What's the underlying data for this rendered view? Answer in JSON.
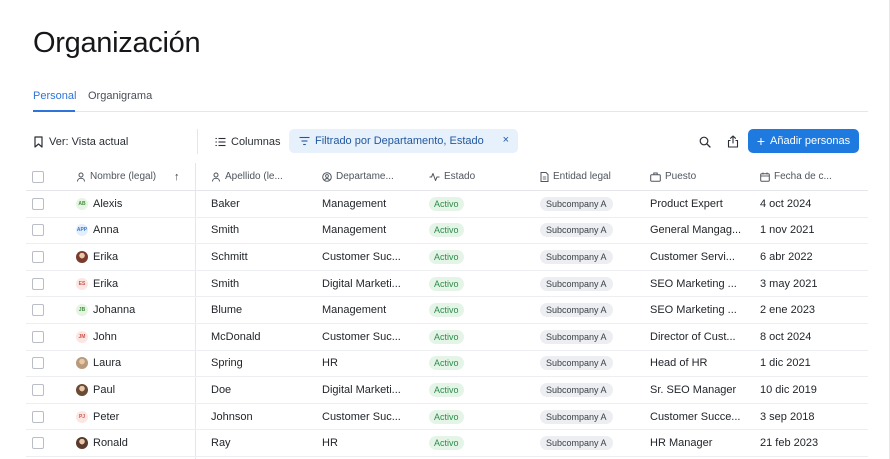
{
  "page": {
    "title": "Organización",
    "tabs": [
      {
        "label": "Personal",
        "active": true
      },
      {
        "label": "Organigrama",
        "active": false
      }
    ]
  },
  "toolbar": {
    "view_label": "Ver: Vista actual",
    "columns_label": "Columnas",
    "filter_label": "Filtrado por Departamento, Estado",
    "filter_clear": "×",
    "add_label": "Añadir personas",
    "add_plus": "+"
  },
  "table": {
    "headers": {
      "name": "Nombre (legal)",
      "sort_arrow": "↑",
      "last": "Apellido (le...",
      "dept": "Departame...",
      "status": "Estado",
      "entity": "Entidad legal",
      "position": "Puesto",
      "date": "Fecha de c..."
    },
    "rows": [
      {
        "initials": "AB",
        "avatar_bg": "#e6f4e4",
        "avatar_fg": "#3f8f3a",
        "photo": false,
        "name": "Alexis",
        "last": "Baker",
        "dept": "Management",
        "status": "Activo",
        "entity": "Subcompany A",
        "position": "Product Expert",
        "date": "4 oct 2024"
      },
      {
        "initials": "APP",
        "avatar_bg": "#e4effc",
        "avatar_fg": "#3b78c8",
        "photo": false,
        "name": "Anna",
        "last": "Smith",
        "dept": "Management",
        "status": "Activo",
        "entity": "Subcompany A",
        "position": "General Mangag...",
        "date": "1 nov 2021"
      },
      {
        "initials": "",
        "avatar_bg": "#7a3b2e",
        "avatar_fg": "#ffffff",
        "photo": true,
        "name": "Erika",
        "last": "Schmitt",
        "dept": "Customer Suc...",
        "status": "Activo",
        "entity": "Subcompany A",
        "position": "Customer Servi...",
        "date": "6 abr 2022"
      },
      {
        "initials": "ES",
        "avatar_bg": "#fbe6e3",
        "avatar_fg": "#c8554a",
        "photo": false,
        "name": "Erika",
        "last": "Smith",
        "dept": "Digital Marketi...",
        "status": "Activo",
        "entity": "Subcompany A",
        "position": "SEO Marketing ...",
        "date": "3 may 2021"
      },
      {
        "initials": "JB",
        "avatar_bg": "#e6f4e4",
        "avatar_fg": "#3f8f3a",
        "photo": false,
        "name": "Johanna",
        "last": "Blume",
        "dept": "Management",
        "status": "Activo",
        "entity": "Subcompany A",
        "position": "SEO Marketing ...",
        "date": "2 ene 2023"
      },
      {
        "initials": "JM",
        "avatar_bg": "#fbe6e3",
        "avatar_fg": "#c8554a",
        "photo": false,
        "name": "John",
        "last": "McDonald",
        "dept": "Customer Suc...",
        "status": "Activo",
        "entity": "Subcompany A",
        "position": "Director of Cust...",
        "date": "8 oct 2024"
      },
      {
        "initials": "",
        "avatar_bg": "#b89a7d",
        "avatar_fg": "#ffffff",
        "photo": true,
        "name": "Laura",
        "last": "Spring",
        "dept": "HR",
        "status": "Activo",
        "entity": "Subcompany A",
        "position": "Head of HR",
        "date": "1 dic 2021"
      },
      {
        "initials": "",
        "avatar_bg": "#6b4a36",
        "avatar_fg": "#ffffff",
        "photo": true,
        "name": "Paul",
        "last": "Doe",
        "dept": "Digital Marketi...",
        "status": "Activo",
        "entity": "Subcompany A",
        "position": "Sr. SEO Manager",
        "date": "10 dic 2019"
      },
      {
        "initials": "PJ",
        "avatar_bg": "#fbe6e3",
        "avatar_fg": "#c8554a",
        "photo": false,
        "name": "Peter",
        "last": "Johnson",
        "dept": "Customer Suc...",
        "status": "Activo",
        "entity": "Subcompany A",
        "position": "Customer Succe...",
        "date": "3 sep 2018"
      },
      {
        "initials": "",
        "avatar_bg": "#5a3a2c",
        "avatar_fg": "#ffffff",
        "photo": true,
        "name": "Ronald",
        "last": "Ray",
        "dept": "HR",
        "status": "Activo",
        "entity": "Subcompany A",
        "position": "HR Manager",
        "date": "21 feb 2023"
      }
    ]
  },
  "colors": {
    "accent": "#1f7ae0",
    "tab_active": "#2f74d8",
    "filter_bg": "#e6f1fc",
    "active_badge_bg": "#e4f5e8",
    "active_badge_fg": "#2e8a47"
  },
  "icons": {
    "view": "bookmark-icon",
    "columns": "list-icon",
    "filter": "filter-icon",
    "search": "search-icon",
    "share": "share-icon"
  }
}
